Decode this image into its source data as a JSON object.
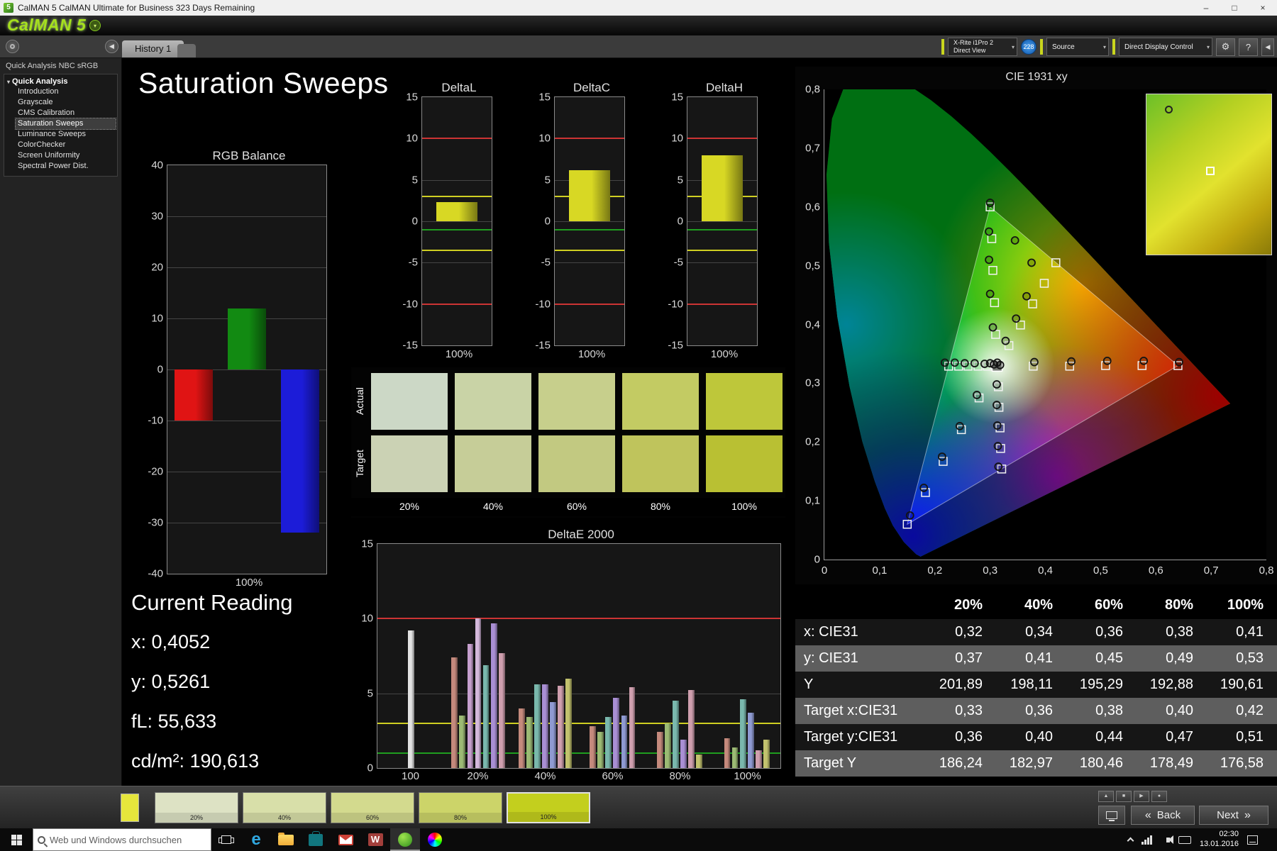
{
  "window": {
    "title": "CalMAN 5 CalMAN Ultimate for Business 323 Days Remaining"
  },
  "logo": {
    "text": "CalMAN 5"
  },
  "tab_bar": {
    "tabs": [
      {
        "label": "History 1",
        "active": true
      }
    ]
  },
  "toolbar": {
    "meter_selector": {
      "line1": "X-Rite i1Pro 2",
      "line2": "Direct View"
    },
    "meter_badge": "228",
    "source_selector": "Source",
    "display_control_selector": "Direct Display Control"
  },
  "sidebar": {
    "title": "Quick Analysis NBC sRGB",
    "root_label": "Quick Analysis",
    "items": [
      "Introduction",
      "Grayscale",
      "CMS Calibration",
      "Saturation Sweeps",
      "Luminance Sweeps",
      "ColorChecker",
      "Screen Uniformity",
      "Spectral Power Dist."
    ],
    "selected_index": 3
  },
  "main": {
    "title": "Saturation Sweeps",
    "current_reading": {
      "title": "Current Reading",
      "x": "x: 0,4052",
      "y": "y: 0,5261",
      "fl": "fL: 55,633",
      "cdm2": "cd/m²: 190,613"
    }
  },
  "swatch_grid": {
    "row_labels": [
      "Actual",
      "Target"
    ],
    "col_labels": [
      "20%",
      "40%",
      "60%",
      "80%",
      "100%"
    ],
    "actual": [
      "#ccd8c6",
      "#c9d3a6",
      "#c7cf8c",
      "#c3cb63",
      "#bec73a"
    ],
    "target": [
      "#cbd2b4",
      "#c6cd98",
      "#c2c981",
      "#bfc45c",
      "#b9c033"
    ]
  },
  "chart_data": [
    {
      "id": "rgb-balance",
      "type": "bar",
      "title": "RGB Balance",
      "categories": [
        "Red",
        "Green",
        "Blue"
      ],
      "values": [
        -10,
        12,
        -32
      ],
      "bar_colors": [
        "#e01414",
        "#128a12",
        "#1c1cd8"
      ],
      "ylim": [
        -40,
        40
      ],
      "yticks": [
        40,
        30,
        20,
        10,
        0,
        -10,
        -20,
        -30,
        -40
      ],
      "xlabel": "100%"
    },
    {
      "id": "delta-l",
      "type": "bar",
      "title": "DeltaL",
      "categories": [
        "100%"
      ],
      "values": [
        2.3
      ],
      "bar_colors": [
        "#d8d824"
      ],
      "ylim": [
        -15,
        15
      ],
      "yticks": [
        15,
        10,
        5,
        0,
        -5,
        -10,
        -15
      ],
      "ref_lines": [
        {
          "y": 10,
          "color": "#cc3434"
        },
        {
          "y": 3,
          "color": "#cfcf22"
        },
        {
          "y": -1,
          "color": "#1f9e1f"
        },
        {
          "y": -3.5,
          "color": "#cfcf22"
        },
        {
          "y": -10,
          "color": "#cc3434"
        }
      ],
      "xlabel": "100%"
    },
    {
      "id": "delta-c",
      "type": "bar",
      "title": "DeltaC",
      "categories": [
        "100%"
      ],
      "values": [
        6.2
      ],
      "bar_colors": [
        "#d8d824"
      ],
      "ylim": [
        -15,
        15
      ],
      "yticks": [
        15,
        10,
        5,
        0,
        -5,
        -10,
        -15
      ],
      "ref_lines": [
        {
          "y": 10,
          "color": "#cc3434"
        },
        {
          "y": 3,
          "color": "#cfcf22"
        },
        {
          "y": -1,
          "color": "#1f9e1f"
        },
        {
          "y": -3.5,
          "color": "#cfcf22"
        },
        {
          "y": -10,
          "color": "#cc3434"
        }
      ],
      "xlabel": "100%"
    },
    {
      "id": "delta-h",
      "type": "bar",
      "title": "DeltaH",
      "categories": [
        "100%"
      ],
      "values": [
        8.0
      ],
      "bar_colors": [
        "#d8d824"
      ],
      "ylim": [
        -15,
        15
      ],
      "yticks": [
        15,
        10,
        5,
        0,
        -5,
        -10,
        -15
      ],
      "ref_lines": [
        {
          "y": 10,
          "color": "#cc3434"
        },
        {
          "y": 3,
          "color": "#cfcf22"
        },
        {
          "y": -1,
          "color": "#1f9e1f"
        },
        {
          "y": -3.5,
          "color": "#cfcf22"
        },
        {
          "y": -10,
          "color": "#cc3434"
        }
      ],
      "xlabel": "100%"
    },
    {
      "id": "delta-e",
      "type": "grouped_bar",
      "title": "DeltaE 2000",
      "ylim": [
        0,
        15
      ],
      "yticks": [
        15,
        10,
        5,
        0
      ],
      "ref_lines": [
        {
          "y": 10,
          "color": "#cc3434"
        },
        {
          "y": 3,
          "color": "#cfcf22"
        },
        {
          "y": 1,
          "color": "#1f9e1f"
        }
      ],
      "group_labels": [
        "100",
        "20%",
        "40%",
        "60%",
        "80%",
        "100%"
      ],
      "groups": [
        [
          {
            "v": 9.2,
            "c": "#e2e2e2"
          }
        ],
        [
          {
            "v": 7.4,
            "c": "#c58a7d"
          },
          {
            "v": 3.5,
            "c": "#9cba74"
          },
          {
            "v": 8.3,
            "c": "#c7a0cf"
          },
          {
            "v": 10.0,
            "c": "#d4b8dc"
          },
          {
            "v": 6.9,
            "c": "#7ab8ad"
          },
          {
            "v": 9.7,
            "c": "#a98fd4"
          },
          {
            "v": 7.7,
            "c": "#cf9fae"
          }
        ],
        [
          {
            "v": 4.0,
            "c": "#c58a7d"
          },
          {
            "v": 3.4,
            "c": "#9cba74"
          },
          {
            "v": 5.6,
            "c": "#7ab8ad"
          },
          {
            "v": 5.6,
            "c": "#a98fd4"
          },
          {
            "v": 4.4,
            "c": "#8f9ad2"
          },
          {
            "v": 5.5,
            "c": "#cf9fae"
          },
          {
            "v": 6.0,
            "c": "#c2c26e"
          }
        ],
        [
          {
            "v": 2.8,
            "c": "#c58a7d"
          },
          {
            "v": 2.4,
            "c": "#9cba74"
          },
          {
            "v": 3.4,
            "c": "#7ab8ad"
          },
          {
            "v": 4.7,
            "c": "#a98fd4"
          },
          {
            "v": 3.5,
            "c": "#8f9ad2"
          },
          {
            "v": 5.4,
            "c": "#cf9fae"
          }
        ],
        [
          {
            "v": 2.4,
            "c": "#c58a7d"
          },
          {
            "v": 3.0,
            "c": "#9cba74"
          },
          {
            "v": 4.5,
            "c": "#7ab8ad"
          },
          {
            "v": 1.9,
            "c": "#a98fd4"
          },
          {
            "v": 5.2,
            "c": "#cf9fae"
          },
          {
            "v": 0.9,
            "c": "#c2c26e"
          }
        ],
        [
          {
            "v": 2.0,
            "c": "#c58a7d"
          },
          {
            "v": 1.4,
            "c": "#9cba74"
          },
          {
            "v": 4.6,
            "c": "#7ab8ad"
          },
          {
            "v": 3.7,
            "c": "#8f9ad2"
          },
          {
            "v": 1.2,
            "c": "#cf9fae"
          },
          {
            "v": 1.9,
            "c": "#c2c26e"
          }
        ]
      ]
    },
    {
      "id": "cie",
      "type": "scatter",
      "title": "CIE 1931 xy",
      "xlim": [
        0,
        0.8
      ],
      "ylim": [
        0,
        0.8
      ],
      "tick_labels": [
        "0",
        "0,1",
        "0,2",
        "0,3",
        "0,4",
        "0,5",
        "0,6",
        "0,7",
        "0,8"
      ],
      "gamut_triangle": [
        [
          0.64,
          0.33
        ],
        [
          0.3,
          0.6
        ],
        [
          0.15,
          0.06
        ]
      ],
      "white_point": [
        0.3127,
        0.329
      ],
      "target_points": [
        [
          0.378,
          0.329
        ],
        [
          0.444,
          0.329
        ],
        [
          0.509,
          0.33
        ],
        [
          0.575,
          0.33
        ],
        [
          0.64,
          0.33
        ],
        [
          0.31,
          0.383
        ],
        [
          0.308,
          0.437
        ],
        [
          0.305,
          0.492
        ],
        [
          0.303,
          0.546
        ],
        [
          0.3,
          0.6
        ],
        [
          0.28,
          0.275
        ],
        [
          0.248,
          0.221
        ],
        [
          0.215,
          0.167
        ],
        [
          0.183,
          0.114
        ],
        [
          0.15,
          0.06
        ],
        [
          0.334,
          0.364
        ],
        [
          0.355,
          0.399
        ],
        [
          0.377,
          0.435
        ],
        [
          0.398,
          0.47
        ],
        [
          0.419,
          0.505
        ],
        [
          0.295,
          0.329
        ],
        [
          0.278,
          0.329
        ],
        [
          0.26,
          0.329
        ],
        [
          0.243,
          0.329
        ],
        [
          0.225,
          0.329
        ],
        [
          0.315,
          0.294
        ],
        [
          0.316,
          0.259
        ],
        [
          0.318,
          0.224
        ],
        [
          0.319,
          0.189
        ],
        [
          0.321,
          0.154
        ]
      ],
      "measured_points": [
        [
          0.38,
          0.336
        ],
        [
          0.447,
          0.337
        ],
        [
          0.512,
          0.338
        ],
        [
          0.578,
          0.338
        ],
        [
          0.642,
          0.336
        ],
        [
          0.305,
          0.395
        ],
        [
          0.3,
          0.452
        ],
        [
          0.298,
          0.51
        ],
        [
          0.298,
          0.558
        ],
        [
          0.3,
          0.607
        ],
        [
          0.276,
          0.28
        ],
        [
          0.245,
          0.227
        ],
        [
          0.213,
          0.175
        ],
        [
          0.18,
          0.122
        ],
        [
          0.155,
          0.075
        ],
        [
          0.328,
          0.372
        ],
        [
          0.347,
          0.41
        ],
        [
          0.366,
          0.448
        ],
        [
          0.345,
          0.543
        ],
        [
          0.375,
          0.505
        ],
        [
          0.29,
          0.333
        ],
        [
          0.272,
          0.334
        ],
        [
          0.254,
          0.334
        ],
        [
          0.236,
          0.335
        ],
        [
          0.218,
          0.335
        ],
        [
          0.312,
          0.298
        ],
        [
          0.312,
          0.263
        ],
        [
          0.313,
          0.228
        ],
        [
          0.314,
          0.193
        ],
        [
          0.315,
          0.158
        ],
        [
          0.3,
          0.334
        ],
        [
          0.307,
          0.332
        ],
        [
          0.313,
          0.335
        ],
        [
          0.318,
          0.331
        ]
      ]
    }
  ],
  "table": {
    "col_headers": [
      "20%",
      "40%",
      "60%",
      "80%",
      "100%"
    ],
    "rows": [
      {
        "label": "x: CIE31",
        "values": [
          "0,32",
          "0,34",
          "0,36",
          "0,38",
          "0,41"
        ]
      },
      {
        "label": "y: CIE31",
        "values": [
          "0,37",
          "0,41",
          "0,45",
          "0,49",
          "0,53"
        ]
      },
      {
        "label": "Y",
        "values": [
          "201,89",
          "198,11",
          "195,29",
          "192,88",
          "190,61"
        ]
      },
      {
        "label": "Target x:CIE31",
        "values": [
          "0,33",
          "0,36",
          "0,38",
          "0,40",
          "0,42"
        ]
      },
      {
        "label": "Target y:CIE31",
        "values": [
          "0,36",
          "0,40",
          "0,44",
          "0,47",
          "0,51"
        ]
      },
      {
        "label": "Target Y",
        "values": [
          "186,24",
          "182,97",
          "180,46",
          "178,49",
          "176,58"
        ]
      }
    ]
  },
  "bottom_bar": {
    "mini_swatch_color": "#e6e63c",
    "swatches": [
      {
        "label": "20%",
        "color": "#dde2c4",
        "selected": false
      },
      {
        "label": "40%",
        "color": "#d8dfa9",
        "selected": false
      },
      {
        "label": "60%",
        "color": "#d3da8e",
        "selected": false
      },
      {
        "label": "80%",
        "color": "#ccd469",
        "selected": false
      },
      {
        "label": "100%",
        "color": "#c3cf1e",
        "selected": true
      }
    ],
    "back_label": "Back",
    "next_label": "Next"
  },
  "taskbar": {
    "search_placeholder": "Web und Windows durchsuchen",
    "clock": {
      "time": "02:30",
      "date": "13.01.2016"
    }
  }
}
